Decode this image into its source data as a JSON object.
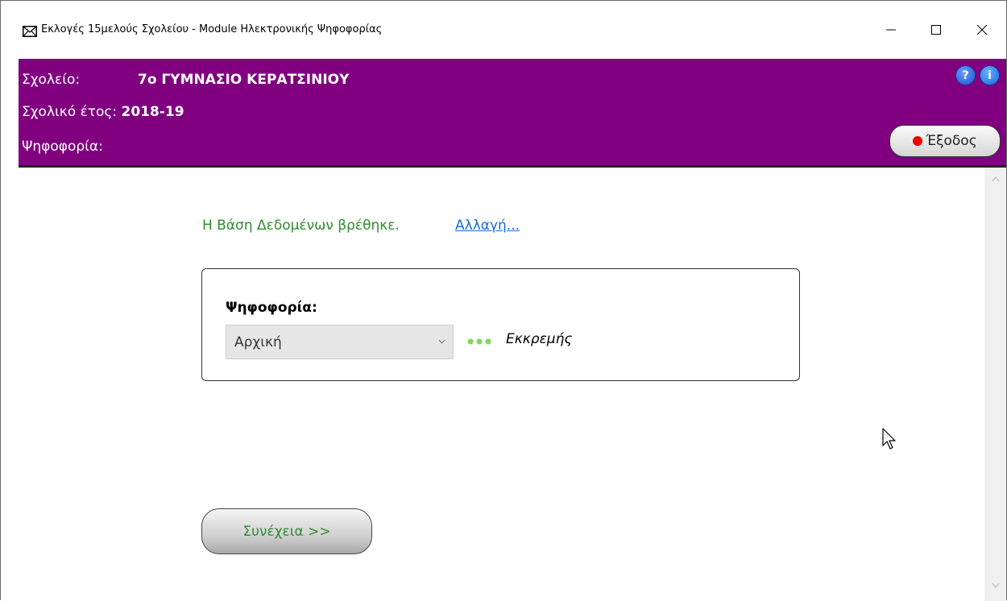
{
  "window": {
    "title": "Εκλογές 15μελούς Σχολείου - Module Ηλεκτρονικής Ψηφοφορίας"
  },
  "header": {
    "school_label": "Σχολείο:",
    "school_name": "7ο ΓΥΜΝΑΣΙΟ ΚΕΡΑΤΣΙΝΙΟΥ",
    "year_label": "Σχολικό έτος:",
    "year_value": "2018-19",
    "vote_label": "Ψηφοφορία:",
    "exit_label": "Έξοδος",
    "help_icon_glyph": "?",
    "info_icon_glyph": "i",
    "background_color": "#800080"
  },
  "main": {
    "db_status": "Η Βάση Δεδομένων βρέθηκε.",
    "db_change_link": "Αλλαγή...",
    "vote_box": {
      "label": "Ψηφοφορία:",
      "selected_option": "Αρχική",
      "status_text": "Εκκρεμής",
      "status_color": "#7ed957"
    },
    "continue_button": "Συνέχεια >>"
  },
  "colors": {
    "status_green": "#2e8b2e",
    "link_blue": "#1a6ad0",
    "exit_dot": "#ee0000"
  }
}
